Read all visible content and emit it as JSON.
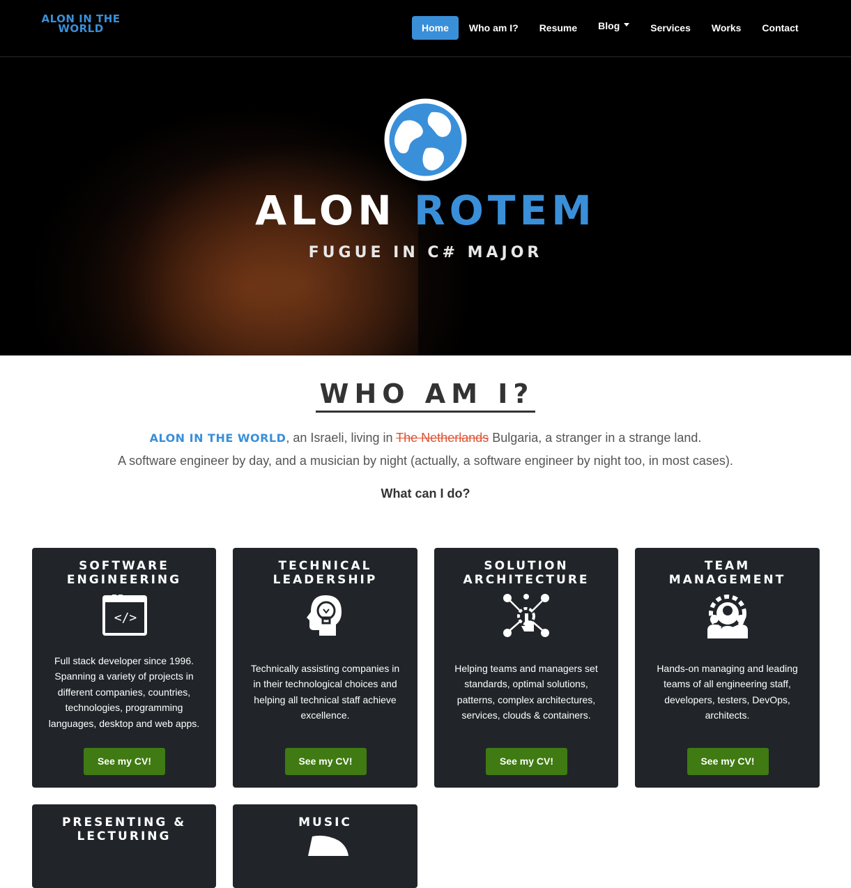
{
  "nav": {
    "brand_line1": "ALON IN THE",
    "brand_line2": "WORLD",
    "items": [
      {
        "label": "Home"
      },
      {
        "label": "Who am I?"
      },
      {
        "label": "Resume"
      },
      {
        "label": "Blog"
      },
      {
        "label": "Services"
      },
      {
        "label": "Works"
      },
      {
        "label": "Contact"
      }
    ]
  },
  "hero": {
    "first_name": "ALON",
    "last_name": "ROTEM",
    "tagline": "FUGUE IN C# MAJOR"
  },
  "about": {
    "title": "WHO AM I?",
    "brand_inline": "ALON IN THE WORLD",
    "line1_a": ", an Israeli, living in ",
    "line1_strike": "The Netherlands",
    "line1_b": " Bulgaria, a stranger in a strange land.",
    "line2": "A software engineer by day, and a musician by night (actually, a software engineer by night too, in most cases).",
    "what_can": "What can I do?"
  },
  "services": [
    {
      "title_1": "SOFTWARE",
      "title_2": "ENGINEERING",
      "icon": "code-window-icon",
      "desc": "Full stack developer since 1996. Spanning a variety of projects in different companies, countries, technologies, programming languages, desktop and web apps.",
      "button": "See my CV!"
    },
    {
      "title_1": "TECHNICAL",
      "title_2": "LEADERSHIP",
      "icon": "lightbulb-head-icon",
      "desc": "Technically assisting companies in in their technological choices and helping all technical staff achieve excellence.",
      "button": "See my CV!"
    },
    {
      "title_1": "SOLUTION",
      "title_2": "ARCHITECTURE",
      "icon": "network-hand-icon",
      "desc": "Helping teams and managers set standards, optimal solutions, patterns, complex architectures, services, clouds & containers.",
      "button": "See my CV!"
    },
    {
      "title_1": "TEAM",
      "title_2": "MANAGEMENT",
      "icon": "team-gear-icon",
      "desc": "Hands-on managing and leading teams of all engineering staff, developers, testers, DevOps, architects.",
      "button": "See my CV!"
    },
    {
      "title_1": "PRESENTING &",
      "title_2": "LECTURING",
      "icon": "",
      "desc": "",
      "button": ""
    },
    {
      "title_1": "MUSIC",
      "title_2": "",
      "icon": "music-icon",
      "desc": "",
      "button": ""
    }
  ],
  "colors": {
    "accent": "#3a8fd9",
    "button": "#3f7a12",
    "card": "#212529",
    "strike": "#e0502f"
  }
}
